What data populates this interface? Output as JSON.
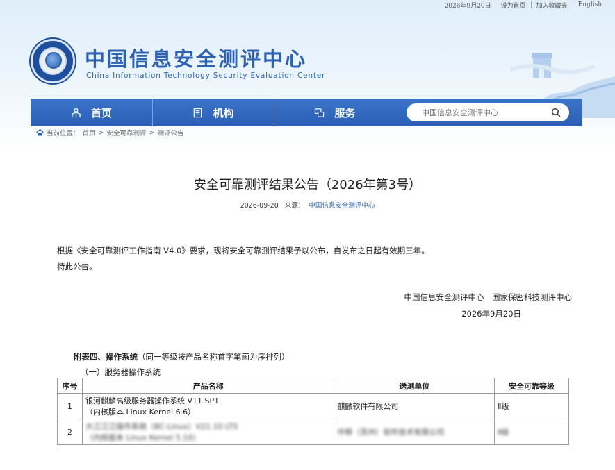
{
  "top_links": {
    "date": "2026年9月20日",
    "set_homepage": "设为首页",
    "add_favorite": "加入收藏夹",
    "english": "English"
  },
  "logo": {
    "title_cn": "中国信息安全测评中心",
    "title_en": "China Information Technology Security Evaluation Center"
  },
  "nav": {
    "items": [
      {
        "label": "首页",
        "icon": "home-icon"
      },
      {
        "label": "机构",
        "icon": "building-icon"
      },
      {
        "label": "服务",
        "icon": "service-icon"
      }
    ],
    "search_placeholder": "中国信息安全测评中心"
  },
  "breadcrumb": {
    "prefix": "当前位置：",
    "path": [
      "首页",
      "安全可靠测评",
      "测评公告"
    ],
    "separator": ">"
  },
  "article": {
    "title": "安全可靠测评结果公告（2026年第3号）",
    "date": "2026-09-20",
    "source_label": "来源：",
    "source": "中国信息安全测评中心",
    "paragraphs": [
      "根据《安全可靠测评工作指南 V4.0》要求，现将安全可靠测评结果予以公布，自发布之日起有效期三年。",
      "特此公告。"
    ],
    "signers": "中国信息安全测评中心　国家保密科技测评中心",
    "sign_date": "2026年9月20日",
    "appendix_bold": "附表四、操作系统",
    "appendix_note": "（同一等级按产品名称首字笔画为序排列）",
    "subsection": "（一）服务器操作系统"
  },
  "table": {
    "headers": [
      "序号",
      "产品名称",
      "送测单位",
      "安全可靠等级"
    ],
    "rows": [
      {
        "index": "1",
        "name_line1": "银河麒麟高级服务器操作系统 V11 SP1",
        "name_line2": "（内核版本 Linux Kernel 6.6）",
        "unit": "麒麟软件有限公司",
        "grade": "Ⅱ级"
      },
      {
        "index": "2",
        "name_line1": "大江江江操作系统（BC-Linux）V21.10 LTS",
        "name_line2": "（内核版本 Linux Kernel 5.10）",
        "unit": "中移（苏州）软件技术有限公司",
        "grade": "Ⅱ级"
      }
    ]
  }
}
